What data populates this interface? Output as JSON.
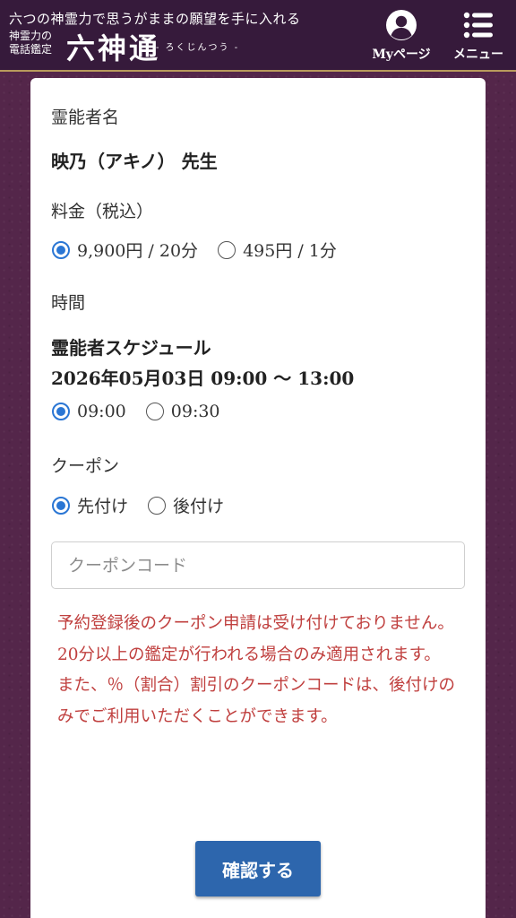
{
  "header": {
    "tagline": "六つの神霊力で思うがままの願望を手に入れる",
    "logo_sub": "神霊力の\n電話鑑定",
    "logo_main": "六神通",
    "logo_reading": "- ろくじんつう -",
    "mypage_label": "Myページ",
    "mypage_icon": "user-circle-icon",
    "menu_label": "メニュー",
    "menu_icon": "list-menu-icon",
    "bg_color": "#361a3b",
    "border_color": "#b89a5c"
  },
  "form": {
    "psychic_label": "霊能者名",
    "psychic_name": "映乃（アキノ） 先生",
    "fee_label": "料金（税込）",
    "fee_options": [
      {
        "label": "9,900円 / 20分",
        "checked": true
      },
      {
        "label": "495円 / 1分",
        "checked": false
      }
    ],
    "time_label": "時間",
    "schedule_title": "霊能者スケジュール",
    "schedule_range": "2026年05月03日 09:00 〜 13:00",
    "time_options": [
      {
        "label": "09:00",
        "checked": true
      },
      {
        "label": "09:30",
        "checked": false
      }
    ],
    "coupon_label": "クーポン",
    "coupon_options": [
      {
        "label": "先付け",
        "checked": true
      },
      {
        "label": "後付け",
        "checked": false
      }
    ],
    "coupon_placeholder": "クーポンコード",
    "coupon_value": "",
    "notices": [
      "予約登録後のクーポン申請は受け付けておりません。",
      "20分以上の鑑定が行われる場合のみ適用されます。",
      "また、％（割合）割引のクーポンコードは、後付けのみでご利用いただくことができます。"
    ],
    "confirm_label": "確認する"
  },
  "colors": {
    "accent": "#2a76d4",
    "button": "#2d66ad",
    "notice_text": "#c0403f",
    "page_bg": "#54264a"
  }
}
